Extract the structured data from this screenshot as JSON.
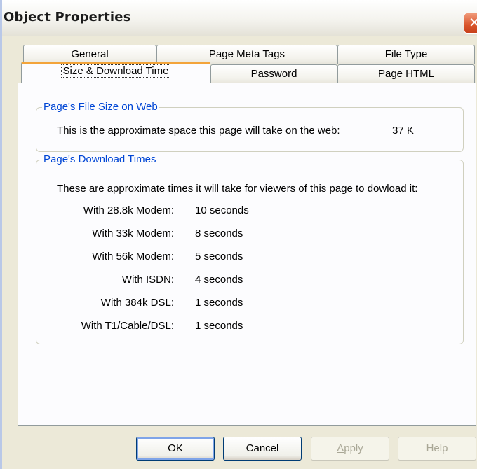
{
  "window": {
    "title": "Object Properties"
  },
  "tabs": {
    "row1": [
      "General",
      "Page Meta Tags",
      "File Type"
    ],
    "row2": [
      "Size & Download Time",
      "Password",
      "Page HTML"
    ]
  },
  "file_size": {
    "group_title": "Page's File Size on Web",
    "description": "This is the approximate space this page will take on the web:",
    "value": "37 K"
  },
  "download_times": {
    "group_title": "Page's Download Times",
    "description": "These are approximate times it will take for viewers of this page to dowload it:",
    "rows": [
      {
        "label": "With 28.8k Modem:",
        "value": "10 seconds"
      },
      {
        "label": "With 33k Modem:",
        "value": "8 seconds"
      },
      {
        "label": "With 56k Modem:",
        "value": "5 seconds"
      },
      {
        "label": "With ISDN:",
        "value": "4 seconds"
      },
      {
        "label": "With 384k DSL:",
        "value": "1 seconds"
      },
      {
        "label": "With T1/Cable/DSL:",
        "value": "1 seconds"
      }
    ]
  },
  "buttons": {
    "ok": "OK",
    "cancel": "Cancel",
    "apply_first": "A",
    "apply_rest": "pply",
    "help": "Help"
  },
  "icons": {
    "close": "close-icon"
  },
  "colors": {
    "group_title": "#0046d5",
    "active_tab_accent": "#f3a43a",
    "close_button": "#d9542a"
  }
}
